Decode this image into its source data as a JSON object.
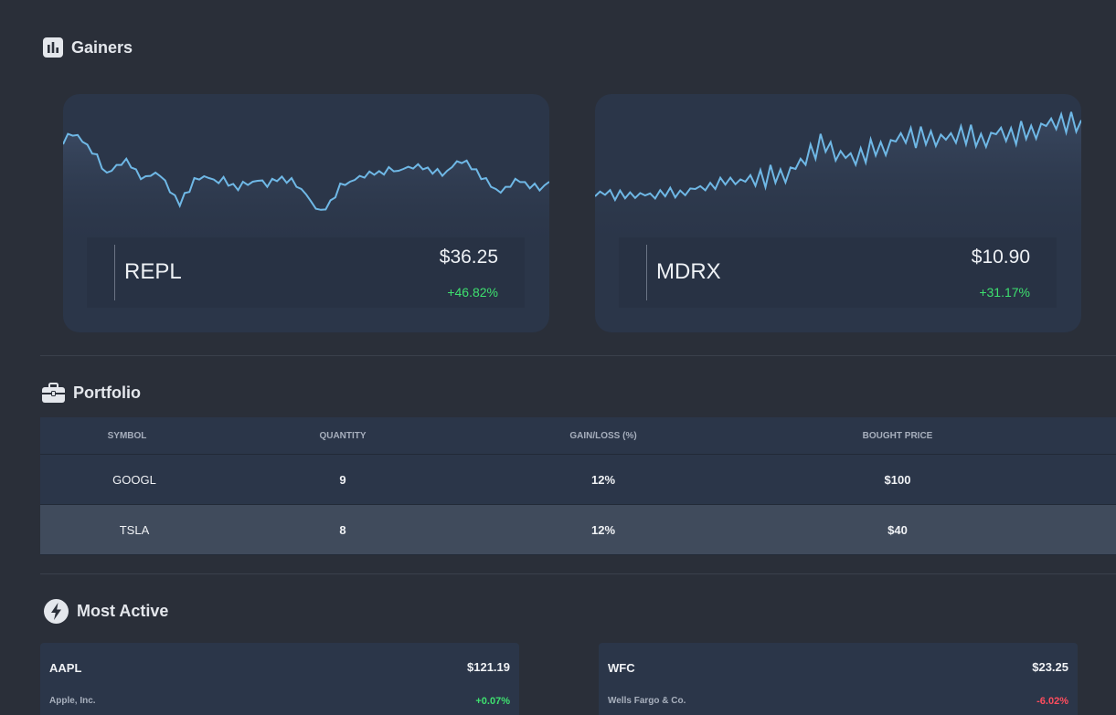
{
  "gainers": {
    "title": "Gainers",
    "cards": [
      {
        "symbol": "REPL",
        "price": "$36.25",
        "change": "+46.82%"
      },
      {
        "symbol": "MDRX",
        "price": "$10.90",
        "change": "+31.17%"
      }
    ]
  },
  "portfolio": {
    "title": "Portfolio",
    "columns": [
      "SYMBOL",
      "QUANTITY",
      "GAIN/LOSS (%)",
      "BOUGHT PRICE"
    ],
    "rows": [
      [
        "GOOGL",
        "9",
        "12%",
        "$100"
      ],
      [
        "TSLA",
        "8",
        "12%",
        "$40"
      ]
    ]
  },
  "most_active": {
    "title": "Most Active",
    "cards": [
      {
        "symbol": "AAPL",
        "price": "$121.19",
        "name": "Apple, Inc.",
        "change": "+0.07%",
        "direction": "up"
      },
      {
        "symbol": "WFC",
        "price": "$23.25",
        "name": "Wells Fargo & Co.",
        "change": "-6.02%",
        "direction": "down"
      }
    ]
  },
  "colors": {
    "background": "#2a2f39",
    "card": "#2b3649",
    "sparkline": "#6fb8e6",
    "positive": "#3ee06f",
    "negative": "#ff4d5e"
  },
  "icons": {
    "gainers": "bar-chart-icon",
    "portfolio": "briefcase-icon",
    "most_active": "lightning-icon"
  }
}
